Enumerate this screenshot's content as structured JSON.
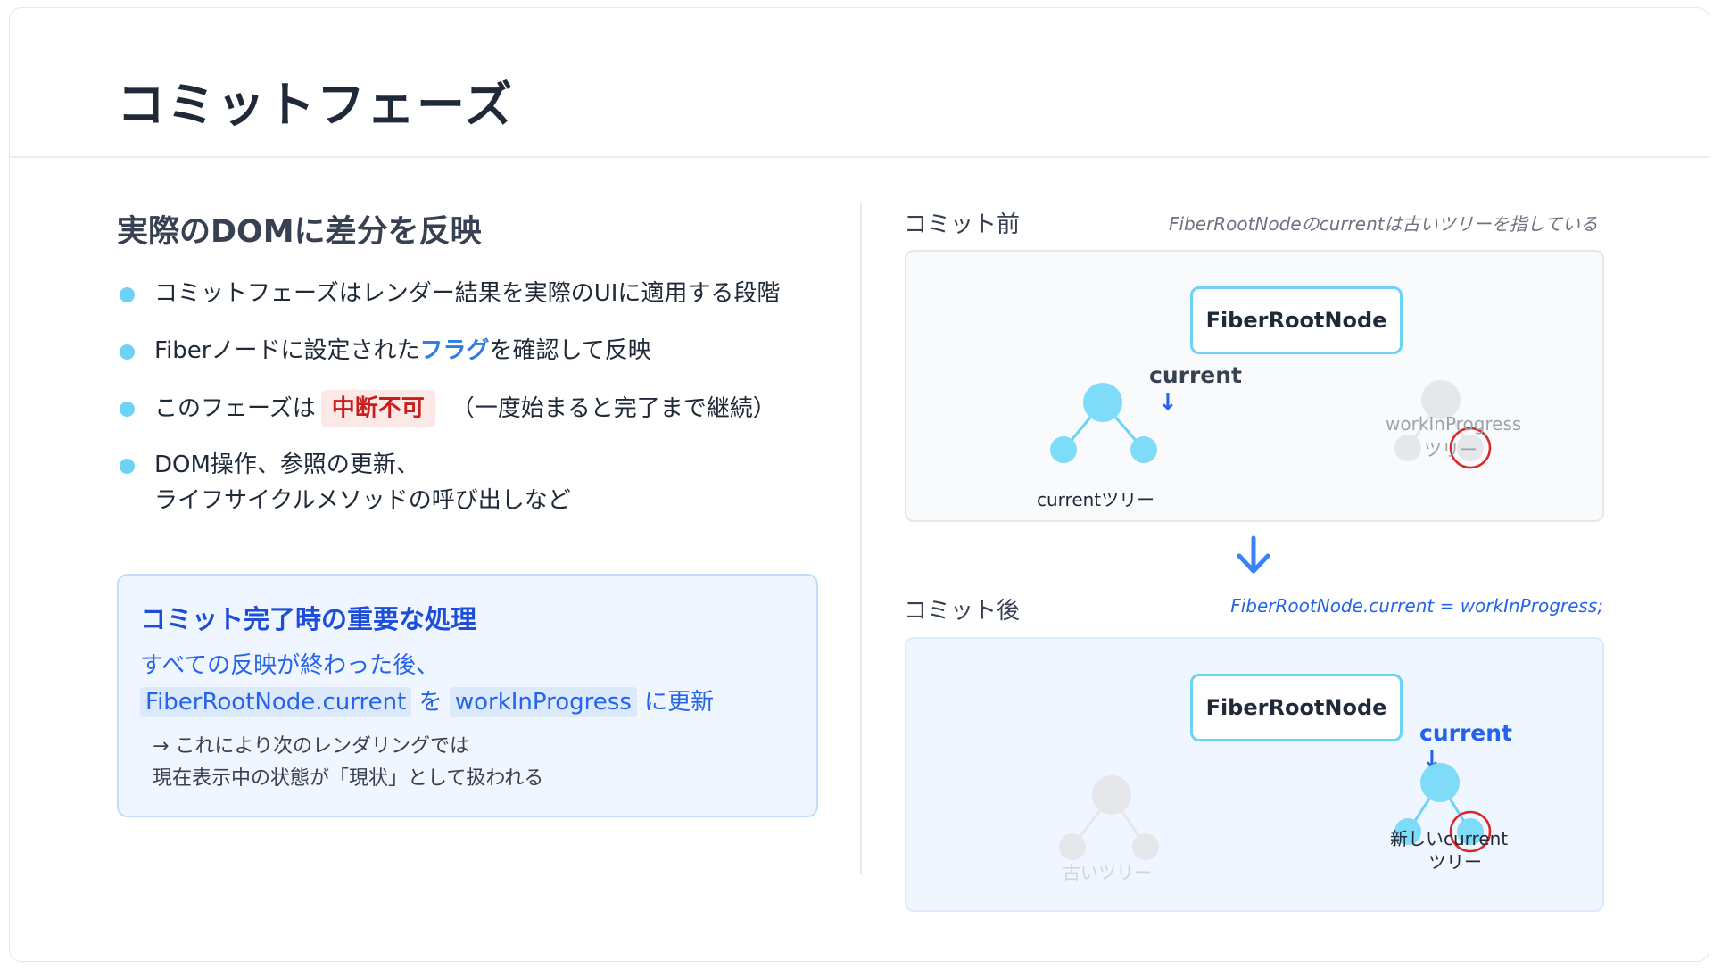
{
  "slide": {
    "title": "コミットフェーズ"
  },
  "left": {
    "heading": "実際のDOMに差分を反映",
    "bullets": [
      {
        "text": "コミットフェーズはレンダー結果を実際のUIに適用する段階"
      },
      {
        "before": "Fiberノードに設定された",
        "highlight": "フラグ",
        "after": "を確認して反映"
      },
      {
        "before": "このフェーズは",
        "badge": "中断不可",
        "after": "（一度始まると完了まで継続）"
      },
      {
        "line1": "DOM操作、参照の更新、",
        "line2": "ライフサイクルメソッドの呼び出しなど"
      }
    ],
    "note": {
      "title": "コミット完了時の重要な処理",
      "line1": "すべての反映が終わった後、",
      "code1": "FiberRootNode.current",
      "conn": "を",
      "code2": "workInProgress",
      "tail": "に更新",
      "sub1": "→ これにより次のレンダリングでは",
      "sub2": "現在表示中の状態が「現状」として扱われる"
    }
  },
  "right": {
    "before": {
      "label": "コミット前",
      "caption": "FiberRootNodeのcurrentは古いツリーを指している",
      "root": "FiberRootNode",
      "pointer": "current",
      "current_tree": "currentツリー",
      "wip_line1": "workInProgress",
      "wip_line2": "ツリー"
    },
    "after": {
      "label": "コミット後",
      "caption": "FiberRootNode.current = workInProgress;",
      "root": "FiberRootNode",
      "pointer": "current",
      "old_tree": "古いツリー",
      "new_line1": "新しいcurrent",
      "new_line2": "ツリー"
    }
  },
  "icons": {
    "bullet": "bullet-dot",
    "pointer_arrow": "arrow-down-icon",
    "transition_arrow": "arrow-down-icon",
    "updated_marker": "red-circle-marker"
  },
  "colors": {
    "accent": "#6dd3f5",
    "blue": "#2563eb",
    "danger": "#c81e1e",
    "inactive": "#e5e7eb"
  }
}
